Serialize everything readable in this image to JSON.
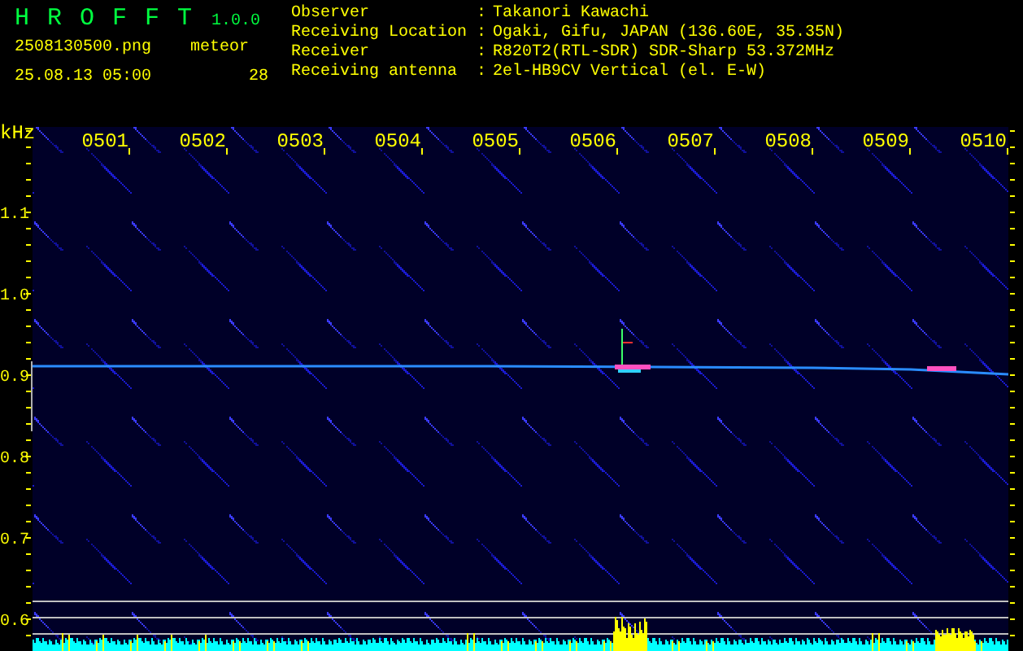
{
  "header": {
    "app_name": "H R O F F T",
    "version": "1.0.0",
    "file_name": "2508130500.png",
    "timestamp": "25.08.13 05:00",
    "counter_label": "meteor",
    "counter_value": "28"
  },
  "station_info": [
    {
      "label": "Observer",
      "separator": ":",
      "value": "Takanori Kawachi"
    },
    {
      "label": "Receiving Location",
      "separator": ":",
      "value": "Ogaki, Gifu, JAPAN (136.60E, 35.35N)"
    },
    {
      "label": "Receiver",
      "separator": ":",
      "value": "R820T2(RTL-SDR) SDR-Sharp 53.372MHz"
    },
    {
      "label": "Receiving antenna",
      "separator": ":",
      "value": "2el-HB9CV Vertical (el. E-W)"
    }
  ],
  "spectrogram": {
    "y_unit": "kHz",
    "y_labels": [
      "1.1",
      "1.0",
      "0.9",
      "0.8",
      "0.7",
      "0.6"
    ],
    "time_labels": [
      "0501",
      "0502",
      "0503",
      "0504",
      "0505",
      "0506",
      "0507",
      "0508",
      "0509",
      "0510"
    ]
  }
}
